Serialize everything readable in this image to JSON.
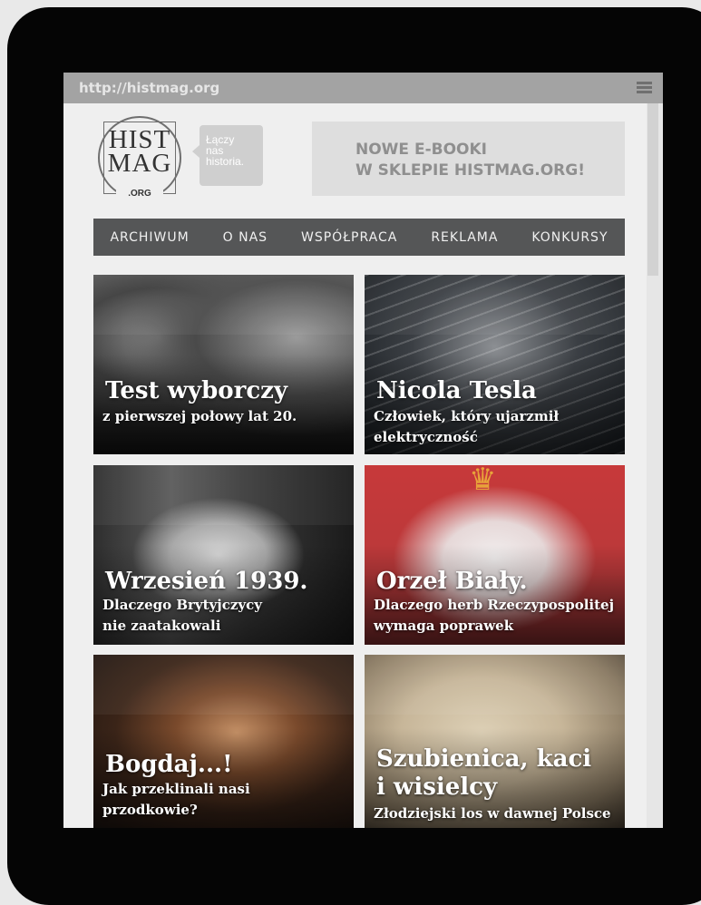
{
  "browser": {
    "url": "http://histmag.org",
    "menu_icon": "hamburger-icon"
  },
  "header": {
    "logo_line1": "HIST",
    "logo_line2": "MAG",
    "logo_org": ".ORG",
    "tagline": "Łączy\nnas\nhistoria.",
    "promo": "NOWE E-BOOKI\nW SKLEPIE HISTMAG.ORG!"
  },
  "nav": {
    "items": [
      "ARCHIWUM",
      "O NAS",
      "WSPÓŁPRACA",
      "REKLAMA",
      "KONKURSY"
    ]
  },
  "tiles": [
    {
      "title": "Test wyborczy",
      "subtitle": "z pierwszej połowy lat 20."
    },
    {
      "title": "Nicola Tesla",
      "subtitle": "Człowiek, który ujarzmił\nelektryczność"
    },
    {
      "title": "Wrzesień 1939.",
      "subtitle": "Dlaczego Brytyjczycy\nnie zaatakowali"
    },
    {
      "title": "Orzeł Biały.",
      "subtitle": "Dlaczego herb Rzeczypospolitej\nwymaga poprawek"
    },
    {
      "title": "Bogdaj...!",
      "subtitle": "Jak przeklinali nasi\nprzodkowie?"
    },
    {
      "title": "Szubienica, kaci\ni wisielcy",
      "subtitle": "Złodziejski los w dawnej Polsce"
    }
  ],
  "colors": {
    "nav_bg": "#555657",
    "urlbar_bg": "#a3a3a3",
    "page_bg": "#efefef"
  }
}
